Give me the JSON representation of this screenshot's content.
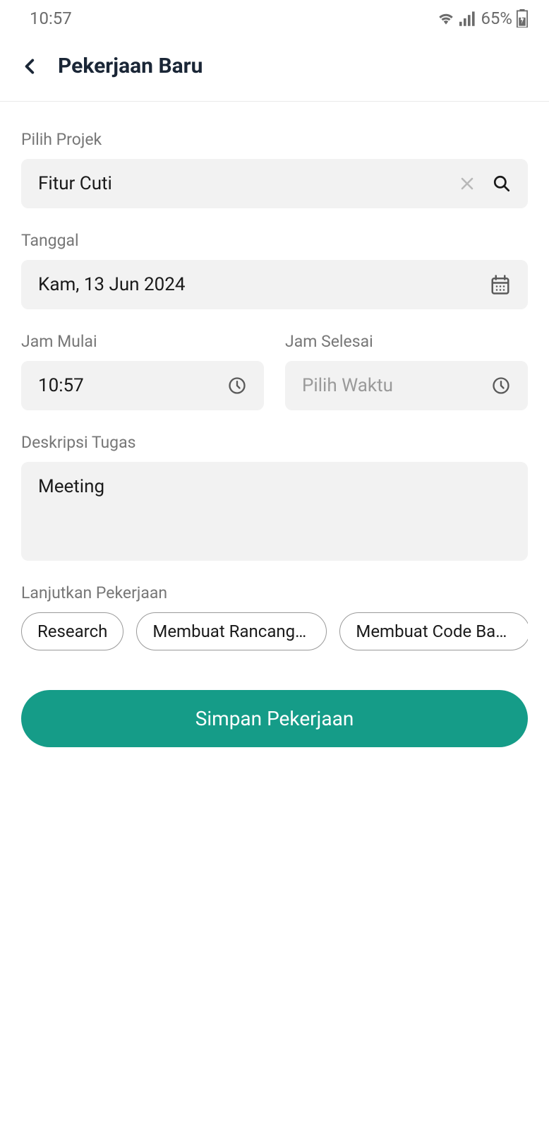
{
  "statusBar": {
    "time": "10:57",
    "battery": "65%"
  },
  "header": {
    "title": "Pekerjaan Baru"
  },
  "form": {
    "project": {
      "label": "Pilih Projek",
      "value": "Fitur Cuti"
    },
    "date": {
      "label": "Tanggal",
      "value": "Kam, 13 Jun 2024"
    },
    "timeStart": {
      "label": "Jam Mulai",
      "value": "10:57"
    },
    "timeEnd": {
      "label": "Jam Selesai",
      "placeholder": "Pilih Waktu"
    },
    "description": {
      "label": "Deskripsi Tugas",
      "value": "Meeting"
    },
    "continueWork": {
      "label": "Lanjutkan Pekerjaan",
      "chips": [
        "Research",
        "Membuat Rancangan...",
        "Membuat Code Back..."
      ]
    },
    "submit": {
      "label": "Simpan Pekerjaan"
    }
  }
}
